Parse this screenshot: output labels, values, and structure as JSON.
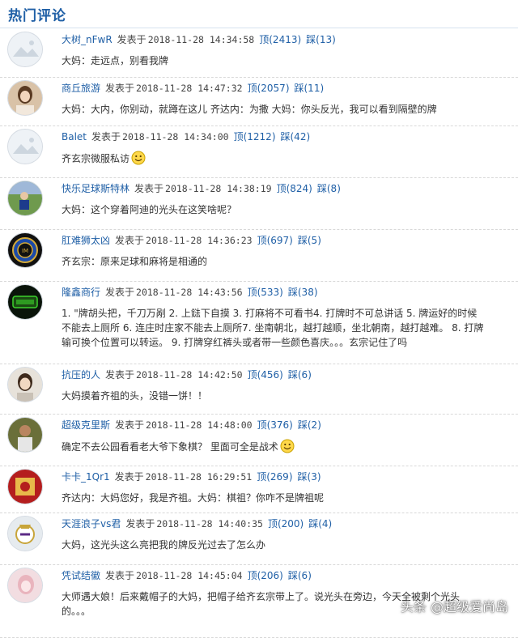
{
  "header": {
    "title": "热门评论"
  },
  "labels": {
    "posted": "发表于",
    "up_prefix": "顶",
    "down_prefix": "踩"
  },
  "colors": {
    "link": "#1f5fa6",
    "text": "#333333",
    "divider": "#d8d8d8"
  },
  "comments": [
    {
      "avatar": "default-avatar-icon",
      "username": "大树_nFwR",
      "date": "2018-11-28 14:34:58",
      "up": "顶(2413)",
      "down": "踩(13)",
      "lines": [
        "大妈：走远点，别看我牌"
      ],
      "smiley": false
    },
    {
      "avatar": "girl-avatar-icon",
      "username": "商丘旅游",
      "date": "2018-11-28 14:47:32",
      "up": "顶(2057)",
      "down": "踩(11)",
      "lines": [
        "大妈：大内，你别动，就蹲在这儿 齐达内：为撒 大妈：你头反光，我可以看到隔壁的牌"
      ],
      "smiley": false
    },
    {
      "avatar": "default-avatar-icon",
      "username": "Balet",
      "date": "2018-11-28 14:34:00",
      "up": "顶(1212)",
      "down": "踩(42)",
      "lines": [
        "齐玄宗微服私访"
      ],
      "smiley": true
    },
    {
      "avatar": "football-avatar-icon",
      "username": "快乐足球斯特林",
      "date": "2018-11-28 14:38:19",
      "up": "顶(824)",
      "down": "踩(8)",
      "lines": [
        "大妈：这个穿着阿迪的光头在这笑啥呢？"
      ],
      "smiley": false
    },
    {
      "avatar": "inter-logo-avatar-icon",
      "username": "肛难狮太凶",
      "date": "2018-11-28 14:36:23",
      "up": "顶(697)",
      "down": "踩(5)",
      "lines": [
        "齐玄宗：原来足球和麻将是相通的"
      ],
      "smiley": false
    },
    {
      "avatar": "green-logo-avatar-icon",
      "username": "隆鑫商行",
      "date": "2018-11-28 14:43:56",
      "up": "顶(533)",
      "down": "踩(38)",
      "lines": [
        "1. \"牌胡头把，千刀万剐 2. 上鍅下自摸 3. 打麻将不可看书4. 打牌时不可总讲话 5. 牌运好的时候",
        "不能去上厕所 6. 连庄时庄家不能去上厕所7. 坐南朝北，越打越顺，坐北朝南，越打越难。 8. 打牌",
        "输可换个位置可以转运。 9. 打牌穿红裤头或者带一些颜色喜庆。。。玄宗记住了吗"
      ],
      "smiley": false
    },
    {
      "avatar": "portrait-avatar-icon",
      "username": "抗压的人",
      "date": "2018-11-28 14:42:50",
      "up": "顶(456)",
      "down": "踩(6)",
      "lines": [
        "大妈摸着齐祖的头，没错一饼！！"
      ],
      "smiley": false
    },
    {
      "avatar": "player-avatar-icon",
      "username": "超级克里斯",
      "date": "2018-11-28 14:48:00",
      "up": "顶(376)",
      "down": "踩(2)",
      "lines": [
        "确定不去公园看看老大爷下象棋？ 里面可全是战术"
      ],
      "smiley": true
    },
    {
      "avatar": "red-avatar-icon",
      "username": "卡卡_1Qr1",
      "date": "2018-11-28 16:29:51",
      "up": "顶(269)",
      "down": "踩(3)",
      "lines": [
        "齐达内：大妈您好，我是齐祖。大妈：棋祖？你咋不是牌祖呢"
      ],
      "smiley": false
    },
    {
      "avatar": "realmadrid-avatar-icon",
      "username": "天涯浪子vs君",
      "date": "2018-11-28 14:40:35",
      "up": "顶(200)",
      "down": "踩(4)",
      "lines": [
        "大妈，这光头这么亮把我的牌反光过去了怎么办"
      ],
      "smiley": false
    },
    {
      "avatar": "pink-avatar-icon",
      "username": "凭试结徽",
      "date": "2018-11-28 14:45:04",
      "up": "顶(206)",
      "down": "踩(6)",
      "lines": [
        "大师遇大娘！后来戴帽子的大妈，把帽子给齐玄宗带上了。说光头在旁边，今天全被剩个光头",
        "的。。。"
      ],
      "smiley": false
    }
  ],
  "watermark": "头条 @超级爱尚岛"
}
